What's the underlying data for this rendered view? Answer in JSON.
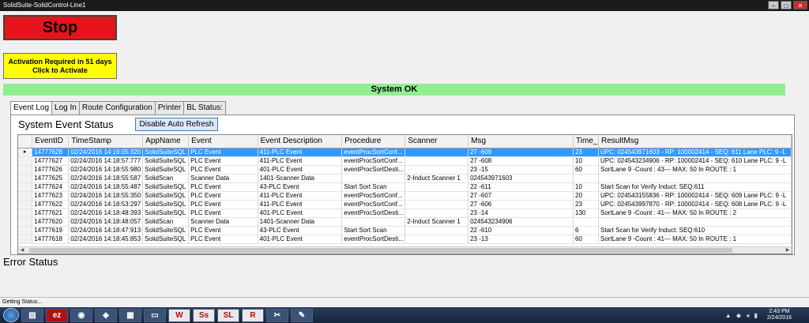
{
  "window": {
    "title": "SolidSuite-SolidControl-Line1",
    "min": "–",
    "max": "□",
    "close": "✕"
  },
  "stop_label": "Stop",
  "activation": {
    "line1": "Activation Required in 51 days",
    "line2": "Click to Activate"
  },
  "system_status": "System OK",
  "tabs": [
    "Event Log",
    "Log In",
    "Route Configuration",
    "Printer",
    "BL Status:"
  ],
  "event_log": {
    "title": "System Event Status",
    "refresh_label": "Disable Auto Refresh",
    "columns": [
      "EventID",
      "TimeStamp",
      "AppName",
      "Event",
      "Event Description",
      "Procedure",
      "Scanner",
      "Msg",
      "Time_",
      "ResultMsg"
    ],
    "rows": [
      [
        "14777628",
        "02/24/2016  14:19:05:320",
        "SolidSuiteSQL",
        "PLC Event",
        "411-PLC Event",
        "eventProcSortConf...",
        "",
        "27   -609",
        "23",
        "UPC: 024543971603 - RP: 100002414 - SEQ: 611 Lane PLC: 9 -L"
      ],
      [
        "14777627",
        "02/24/2016  14:18:57:777",
        "SolidSuiteSQL",
        "PLC Event",
        "411-PLC Event",
        "eventProcSortConf...",
        "",
        "27   -608",
        "10",
        "UPC: 024543234906 - RP: 100002414 - SEQ: 610 Lane PLC: 9 -L"
      ],
      [
        "14777626",
        "02/24/2016  14:18:55:980",
        "SolidSuiteSQL",
        "PLC Event",
        "401-PLC Event",
        "eventProcSortDesti...",
        "",
        "23   -15",
        "60",
        "SortLane  9 -Count : 43--- MAX: 50 In ROUTE : 1"
      ],
      [
        "14777625",
        "02/24/2016  14:18:55:587",
        "SolidScan",
        "Scanner Data",
        "1401-Scanner Data",
        "",
        "2-Induct Scanner 1",
        "024543971603",
        "",
        ""
      ],
      [
        "14777624",
        "02/24/2016  14:18:55:487",
        "SolidSuiteSQL",
        "PLC Event",
        "43-PLC Event",
        "Start Sort Scan",
        "",
        "22   -611",
        "10",
        "Start Scan for Verify Induct: SEQ:611"
      ],
      [
        "14777623",
        "02/24/2016  14:18:55:350",
        "SolidSuiteSQL",
        "PLC Event",
        "411-PLC Event",
        "eventProcSortConf...",
        "",
        "27   -607",
        "20",
        "UPC: 024543155836 - RP: 100002414 - SEQ: 609 Lane PLC: 9 -L"
      ],
      [
        "14777622",
        "02/24/2016  14:18:53:297",
        "SolidSuiteSQL",
        "PLC Event",
        "411-PLC Event",
        "eventProcSortConf...",
        "",
        "27   -606",
        "23",
        "UPC: 024543997870 - RP: 100002414 - SEQ: 608 Lane PLC: 9 -L"
      ],
      [
        "14777621",
        "02/24/2016  14:18:48:393",
        "SolidSuiteSQL",
        "PLC Event",
        "401-PLC Event",
        "eventProcSortDesti...",
        "",
        "23   -14",
        "130",
        "SortLane  9 -Count : 41--- MAX: 50 In ROUTE : 2"
      ],
      [
        "14777620",
        "02/24/2016  14:18:48:057",
        "SolidScan",
        "Scanner Data",
        "1401-Scanner Data",
        "",
        "2-Induct Scanner 1",
        "024543234906",
        "",
        ""
      ],
      [
        "14777619",
        "02/24/2016  14:18:47:913",
        "SolidSuiteSQL",
        "PLC Event",
        "43-PLC Event",
        "Start Sort Scan",
        "",
        "22   -610",
        "6",
        "Start Scan for Verify Induct: SEQ:610"
      ],
      [
        "14777618",
        "02/24/2016  14:18:45:853",
        "SolidSuiteSQL",
        "PLC Event",
        "401-PLC Event",
        "eventProcSortDesti...",
        "",
        "23   -13",
        "60",
        "SortLane  9 -Count : 41--- MAX: 50 In ROUTE : 1"
      ]
    ],
    "selected_row": 0
  },
  "error_status_label": "Error Status",
  "statusbar_text": "Getting Status...",
  "taskbar": {
    "icons": [
      {
        "name": "explorer-icon",
        "glyph": "▤"
      },
      {
        "name": "easy-print-icon",
        "glyph": "ez"
      },
      {
        "name": "chrome-icon",
        "glyph": "◉"
      },
      {
        "name": "network-icon",
        "glyph": "◈"
      },
      {
        "name": "app-window-icon",
        "glyph": "▦"
      },
      {
        "name": "window-icon",
        "glyph": "▭"
      },
      {
        "name": "word-icon",
        "glyph": "W"
      },
      {
        "name": "solidsuite-ss-icon",
        "glyph": "Ss"
      },
      {
        "name": "solidsuite-sl-icon",
        "glyph": "SL"
      },
      {
        "name": "r-app-icon",
        "glyph": "R"
      },
      {
        "name": "tools-icon",
        "glyph": "✂"
      },
      {
        "name": "notes-icon",
        "glyph": "✎"
      }
    ],
    "tray_glyphs": "▲ ◆ ◂ ▮",
    "time": "2:43 PM",
    "date": "2/24/2016"
  }
}
